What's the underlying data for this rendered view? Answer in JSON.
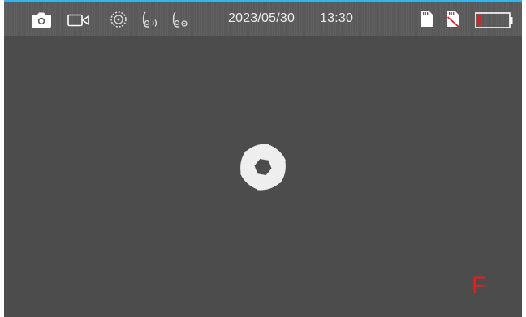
{
  "status_bar": {
    "icons": {
      "photo_mode": "camera-icon",
      "video_mode": "video-camera-icon",
      "timelapse_mode": "timer-dial-icon",
      "pir_sensor_1": "motion-sensor-icon",
      "pir_sensor_2": "motion-sensor-icon",
      "sd_card": "sd-card-icon",
      "sd_card_2": "sd-card-missing-icon",
      "battery": "battery-icon"
    },
    "date": "2023/05/30",
    "time": "13:30",
    "battery_level": 0.1
  },
  "viewfinder": {
    "center_icon": "shutter-aperture-icon",
    "focus_indicator": "F"
  },
  "colors": {
    "accent_top_line": "#3fb1e3",
    "background": "#4c4c4c",
    "warning_red": "#e02020"
  }
}
